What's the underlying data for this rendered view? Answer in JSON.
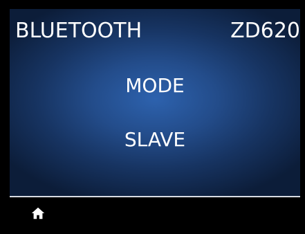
{
  "header": {
    "title": "BLUETOOTH",
    "model": "ZD620"
  },
  "content": {
    "setting_label": "MODE",
    "setting_value": "SLAVE"
  },
  "footer": {
    "home_icon": "home-icon"
  },
  "colors": {
    "screen_center": "#2d62ae",
    "screen_edge": "#0c1d39",
    "text": "#ffffff",
    "frame": "#000000"
  }
}
